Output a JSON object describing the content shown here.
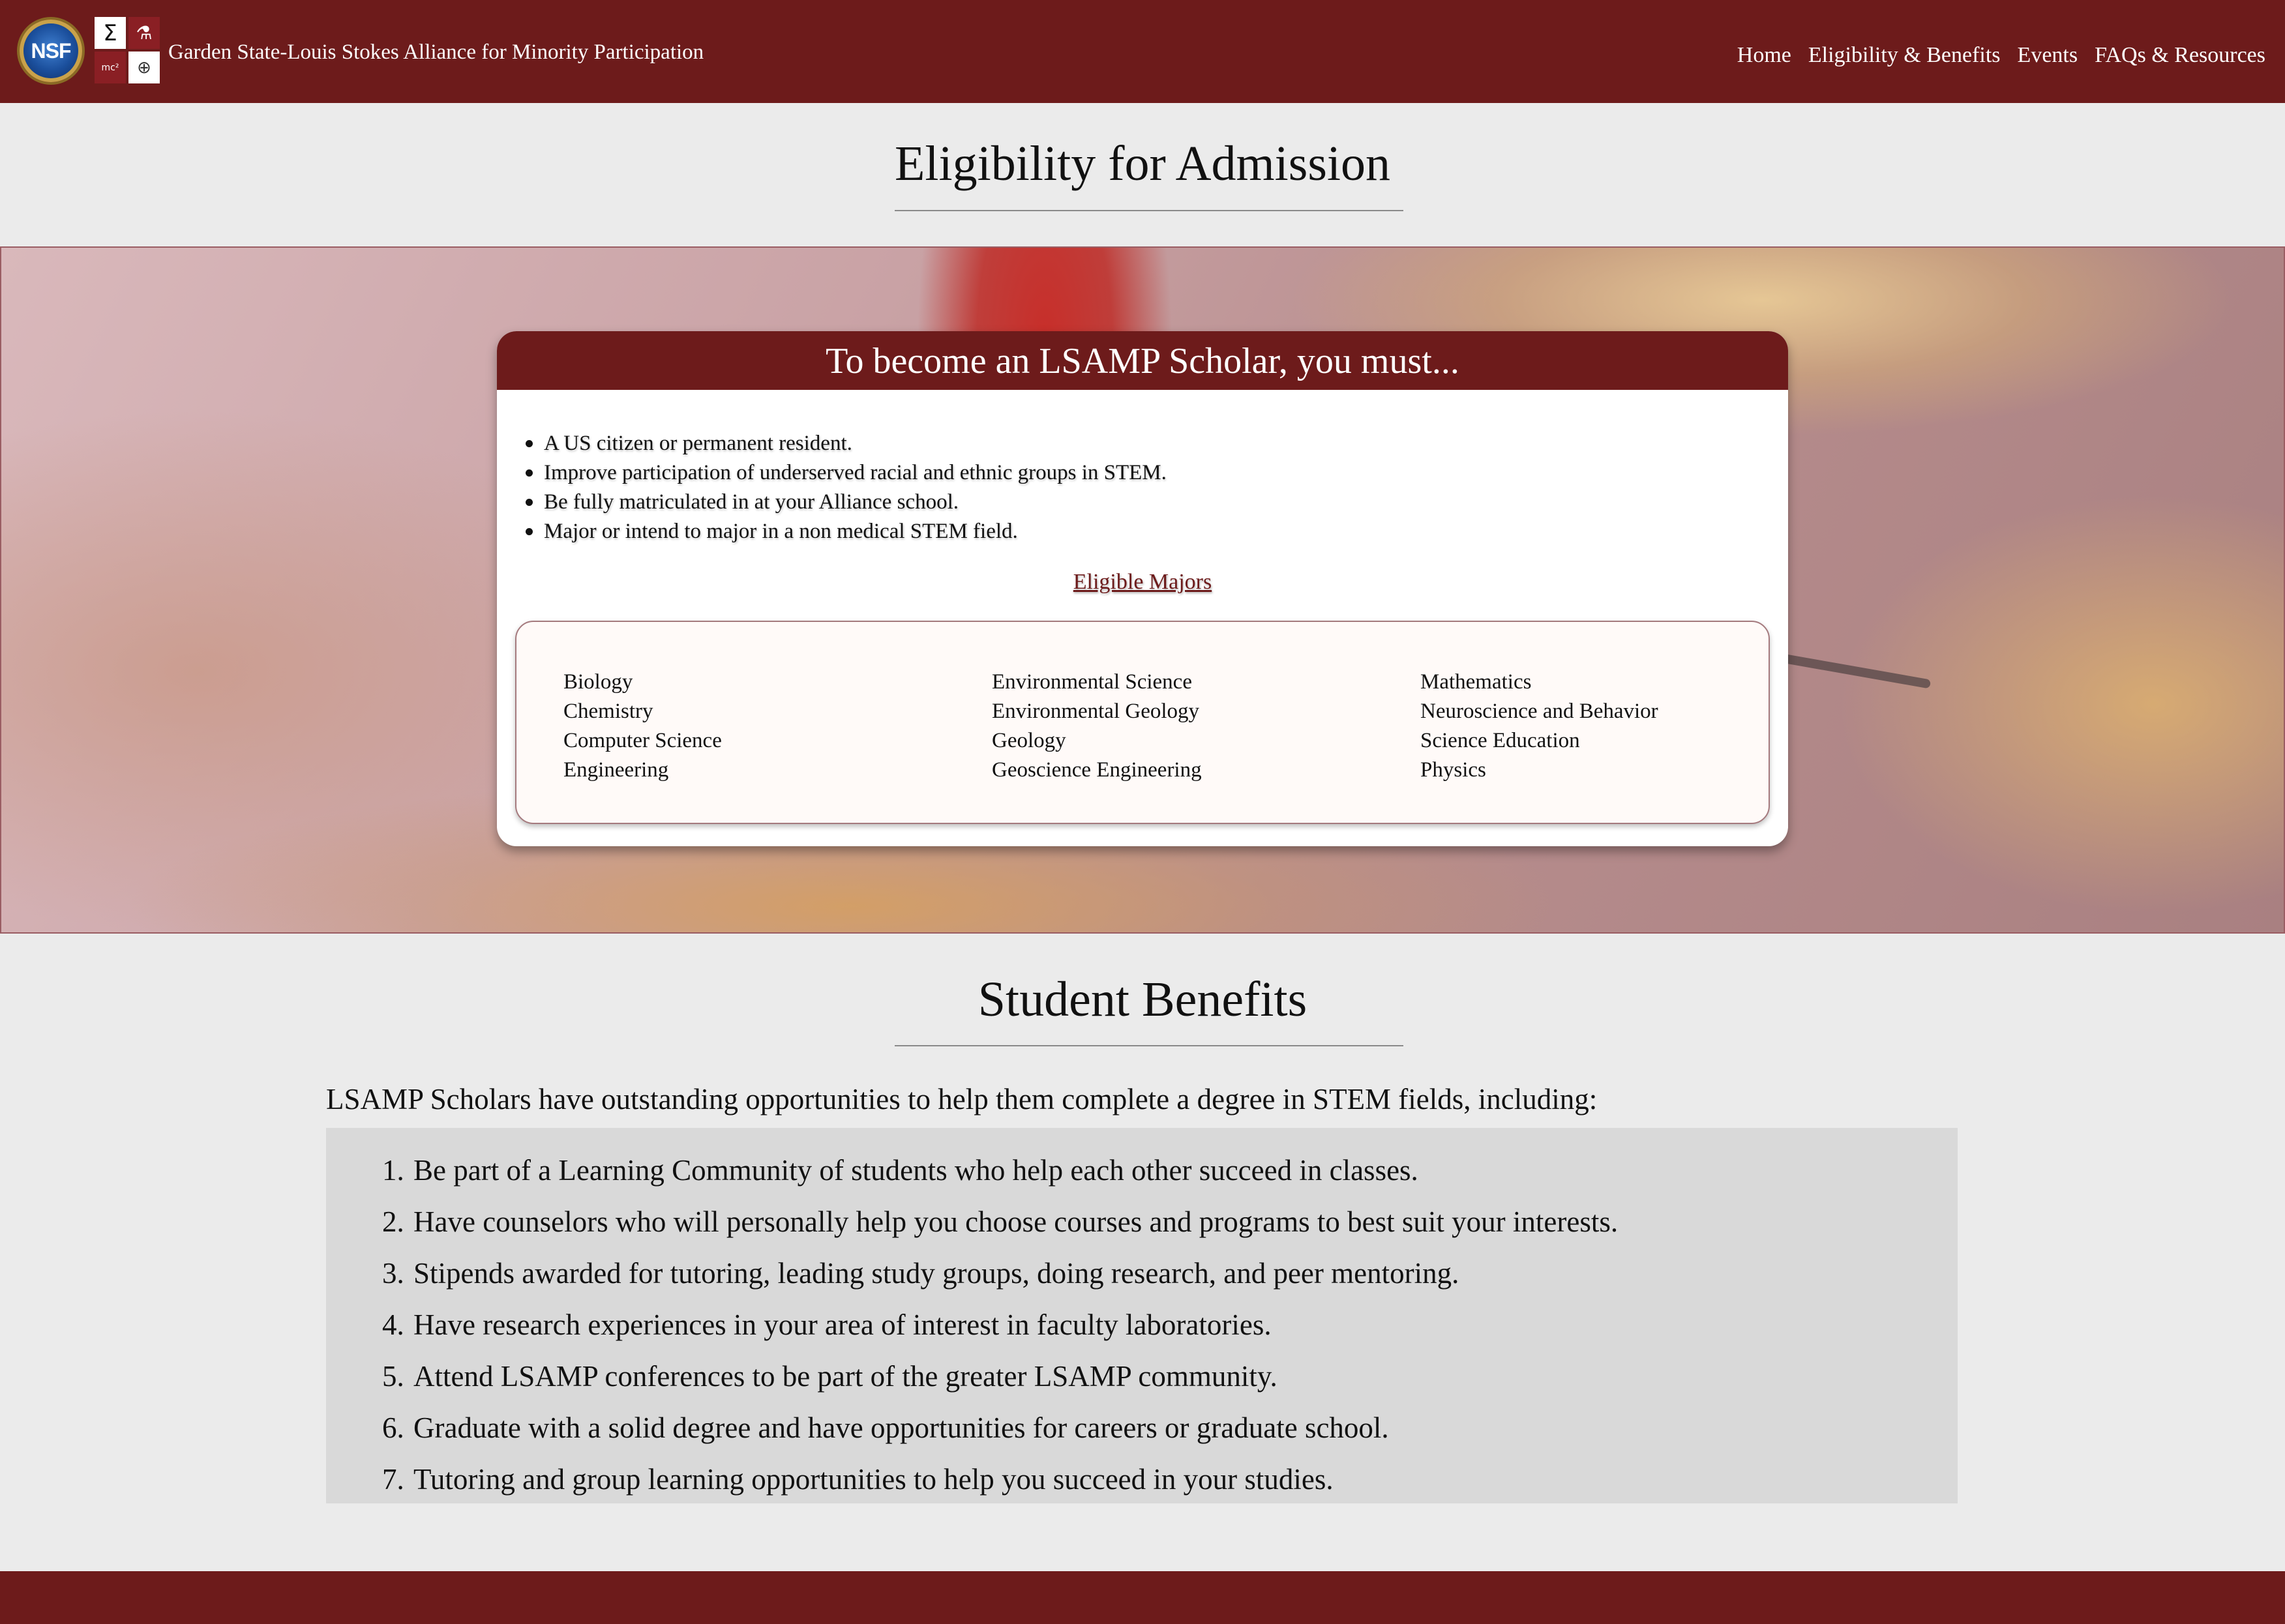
{
  "header": {
    "logo_nsf_text": "NSF",
    "logo_alliance": {
      "sigma": "Σ",
      "flask": "⚗",
      "mc2": "mc²",
      "globe": "⊕"
    },
    "site_title": "Garden State-Louis Stokes Alliance for Minority Participation",
    "nav": [
      {
        "label": "Home"
      },
      {
        "label": "Eligibility & Benefits"
      },
      {
        "label": "Events"
      },
      {
        "label": "FAQs & Resources"
      }
    ]
  },
  "eligibility": {
    "heading": "Eligibility for Admission",
    "card_title": "To become an LSAMP Scholar, you must...",
    "requirements": [
      "A US citizen or permanent resident.",
      "Improve participation of underserved racial and ethnic groups in STEM.",
      "Be fully matriculated in at your Alliance school.",
      "Major or intend to major in a non medical STEM field."
    ],
    "majors_title": "Eligible Majors",
    "majors_columns": [
      [
        "Biology",
        "Chemistry",
        "Computer Science",
        "Engineering"
      ],
      [
        "Environmental Science",
        "Environmental Geology",
        "Geology",
        "Geoscience Engineering"
      ],
      [
        "Mathematics",
        "Neuroscience and Behavior",
        "Science Education",
        "Physics"
      ]
    ]
  },
  "benefits": {
    "heading": "Student Benefits",
    "intro": "LSAMP Scholars have outstanding opportunities to help them complete a degree in STEM fields, including:",
    "items": [
      {
        "num": "1.",
        "text": "Be part of a Learning Community of students who help each other succeed in classes."
      },
      {
        "num": "2.",
        "text": "Have counselors who will personally help you choose courses and programs to best suit your interests."
      },
      {
        "num": "3.",
        "text": "Stipends awarded for tutoring, leading study groups, doing research, and peer mentoring."
      },
      {
        "num": "4.",
        "text": "Have research experiences in your area of interest in faculty laboratories."
      },
      {
        "num": "5.",
        "text": "Attend LSAMP conferences to be part of the greater LSAMP community."
      },
      {
        "num": "6.",
        "text": "Graduate with a solid degree and have opportunities for careers or graduate school."
      },
      {
        "num": "7.",
        "text": "Tutoring and group learning opportunities to help you succeed in your studies."
      }
    ]
  },
  "colors": {
    "brand_maroon": "#6d1b1b",
    "page_background": "#ebebeb",
    "benefits_background": "#d9d9d9"
  }
}
